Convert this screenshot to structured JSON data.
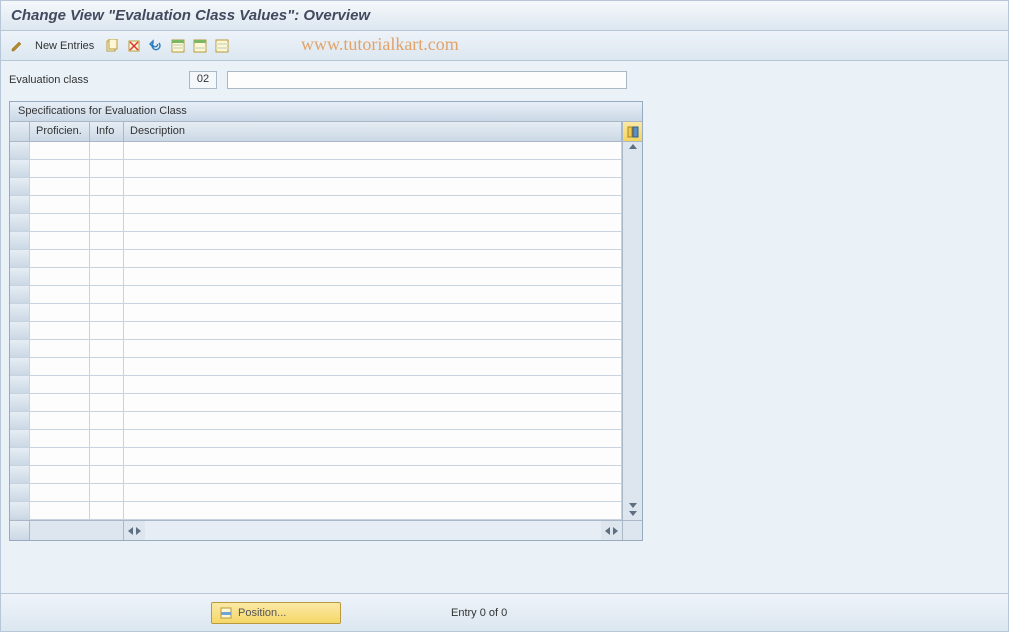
{
  "title": "Change View \"Evaluation Class Values\": Overview",
  "toolbar": {
    "new_entries_label": "New Entries"
  },
  "watermark": "www.tutorialkart.com",
  "field": {
    "label": "Evaluation class",
    "code_value": "02",
    "desc_value": ""
  },
  "panel": {
    "title": "Specifications for Evaluation Class",
    "columns": {
      "proficien": "Proficien.",
      "info": "Info",
      "description": "Description"
    },
    "rows": [
      {
        "proficien": "",
        "info": "",
        "description": ""
      },
      {
        "proficien": "",
        "info": "",
        "description": ""
      },
      {
        "proficien": "",
        "info": "",
        "description": ""
      },
      {
        "proficien": "",
        "info": "",
        "description": ""
      },
      {
        "proficien": "",
        "info": "",
        "description": ""
      },
      {
        "proficien": "",
        "info": "",
        "description": ""
      },
      {
        "proficien": "",
        "info": "",
        "description": ""
      },
      {
        "proficien": "",
        "info": "",
        "description": ""
      },
      {
        "proficien": "",
        "info": "",
        "description": ""
      },
      {
        "proficien": "",
        "info": "",
        "description": ""
      },
      {
        "proficien": "",
        "info": "",
        "description": ""
      },
      {
        "proficien": "",
        "info": "",
        "description": ""
      },
      {
        "proficien": "",
        "info": "",
        "description": ""
      },
      {
        "proficien": "",
        "info": "",
        "description": ""
      },
      {
        "proficien": "",
        "info": "",
        "description": ""
      },
      {
        "proficien": "",
        "info": "",
        "description": ""
      },
      {
        "proficien": "",
        "info": "",
        "description": ""
      },
      {
        "proficien": "",
        "info": "",
        "description": ""
      },
      {
        "proficien": "",
        "info": "",
        "description": ""
      },
      {
        "proficien": "",
        "info": "",
        "description": ""
      },
      {
        "proficien": "",
        "info": "",
        "description": ""
      }
    ]
  },
  "footer": {
    "position_label": "Position...",
    "entry_text": "Entry 0 of 0"
  }
}
